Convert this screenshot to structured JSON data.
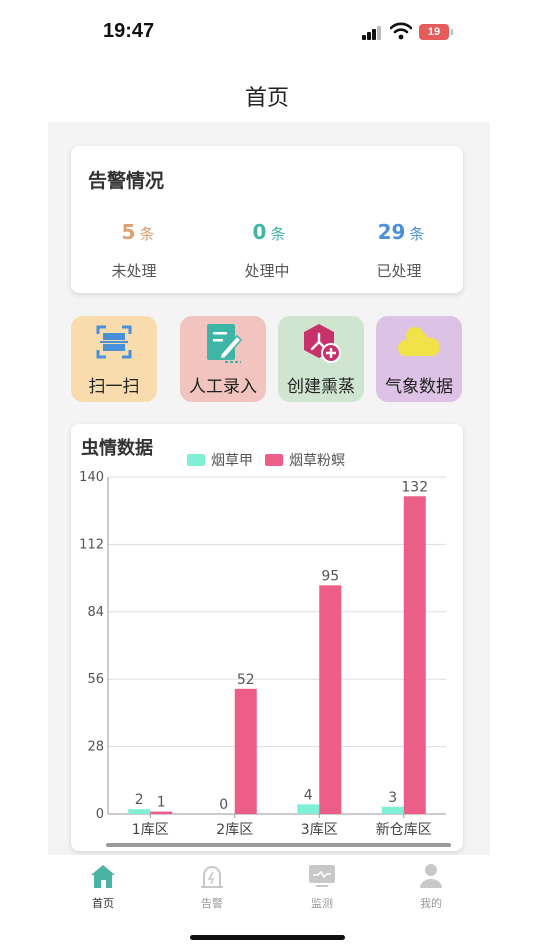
{
  "status_bar": {
    "time": "19:47",
    "battery": "19"
  },
  "header": {
    "title": "首页"
  },
  "alarm": {
    "title": "告警情况",
    "unit": "条",
    "stats": [
      {
        "value": "5",
        "label": "未处理",
        "color": "#e0a070"
      },
      {
        "value": "0",
        "label": "处理中",
        "color": "#3fb5a8"
      },
      {
        "value": "29",
        "label": "已处理",
        "color": "#4a90d9"
      }
    ]
  },
  "tiles": [
    {
      "label": "扫一扫",
      "bg": "#f8dcae",
      "icon": "scan-icon"
    },
    {
      "label": "人工录入",
      "bg": "#f1c4c0",
      "icon": "edit-document-icon"
    },
    {
      "label": "创建熏蒸",
      "bg": "#cfe5cf",
      "icon": "fumigation-add-icon"
    },
    {
      "label": "气象数据",
      "bg": "#dcc3e6",
      "icon": "weather-cloud-icon"
    }
  ],
  "chart_data": {
    "type": "bar",
    "title": "虫情数据",
    "categories": [
      "1库区",
      "2库区",
      "3库区",
      "新仓库区"
    ],
    "series": [
      {
        "name": "烟草甲",
        "values": [
          2,
          0,
          4,
          3
        ],
        "color": "#7ff0d6"
      },
      {
        "name": "烟草粉螟",
        "values": [
          1,
          52,
          95,
          132
        ],
        "color": "#ec5e87"
      }
    ],
    "ylim": [
      0,
      140
    ],
    "yticks": [
      0,
      28,
      56,
      84,
      112,
      140
    ],
    "grid": true,
    "legend": "top"
  },
  "tabbar": {
    "items": [
      {
        "label": "首页",
        "icon": "home-icon",
        "active": true
      },
      {
        "label": "告警",
        "icon": "alarm-icon",
        "active": false
      },
      {
        "label": "监测",
        "icon": "monitor-icon",
        "active": false
      },
      {
        "label": "我的",
        "icon": "user-icon",
        "active": false
      }
    ],
    "active_color": "#4ab3a3",
    "inactive_color": "#c8c8c8"
  }
}
